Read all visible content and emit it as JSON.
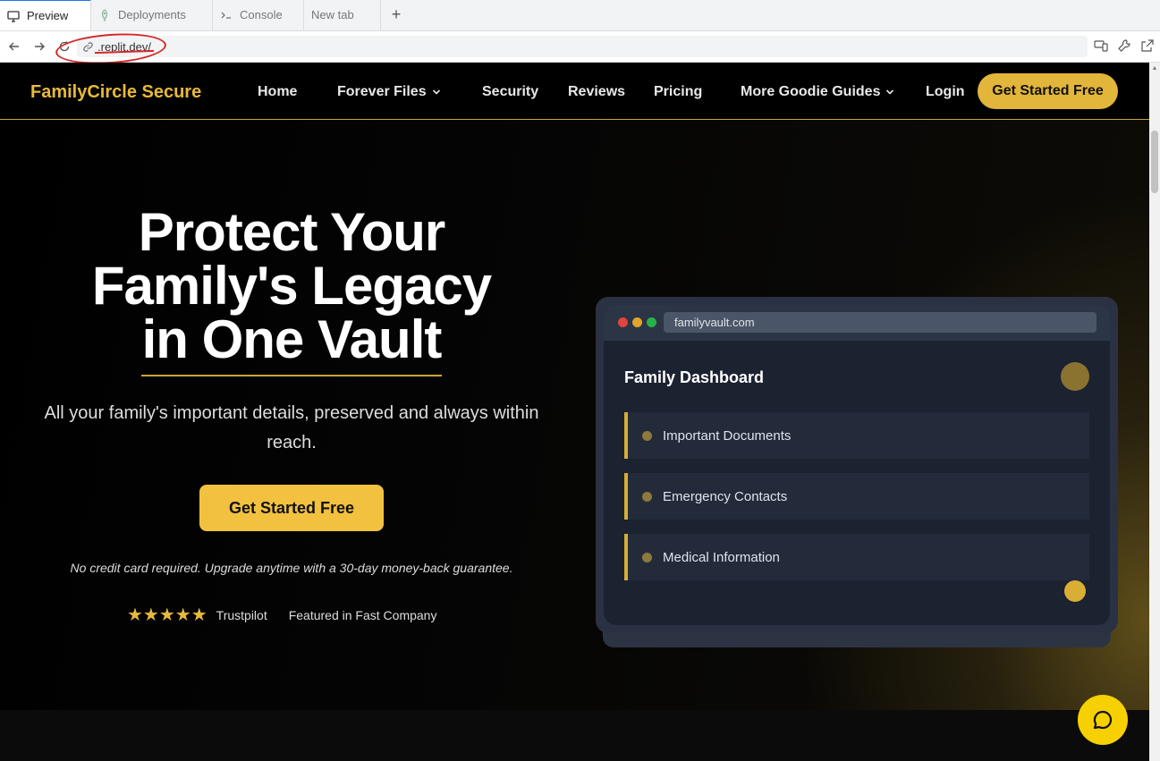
{
  "browser": {
    "tabs": [
      {
        "label": "Preview",
        "icon": "monitor-icon",
        "active": true
      },
      {
        "label": "Deployments",
        "icon": "rocket-icon",
        "active": false
      },
      {
        "label": "Console",
        "icon": "terminal-icon",
        "active": false
      },
      {
        "label": "New tab",
        "icon": "",
        "active": false
      }
    ],
    "new_tab_symbol": "+",
    "url": ".replit.dev/",
    "annotation_color": "#d62828"
  },
  "site": {
    "brand": "FamilyCircle Secure",
    "nav": {
      "home": "Home",
      "forever_files": "Forever Files",
      "security": "Security",
      "reviews": "Reviews",
      "pricing": "Pricing",
      "guides": "More Goodie Guides",
      "login": "Login",
      "cta": "Get Started Free"
    },
    "hero": {
      "headline_1": "Protect Your",
      "headline_2": "Family's Legacy",
      "headline_3": "in One Vault",
      "subhead": "All your family's important details, preserved and always within reach.",
      "cta": "Get Started Free",
      "fineprint": "No credit card required. Upgrade anytime with a 30-day money-back guarantee.",
      "stars": "★★★★★",
      "trust_source": "Trustpilot",
      "featured": "Featured in Fast Company"
    },
    "mockup": {
      "url": "familyvault.com",
      "title": "Family Dashboard",
      "items": [
        "Important Documents",
        "Emergency Contacts",
        "Medical Information"
      ]
    },
    "colors": {
      "accent": "#e2b53b",
      "brand_gold": "#e8b93a",
      "chat": "#f6d000"
    }
  }
}
